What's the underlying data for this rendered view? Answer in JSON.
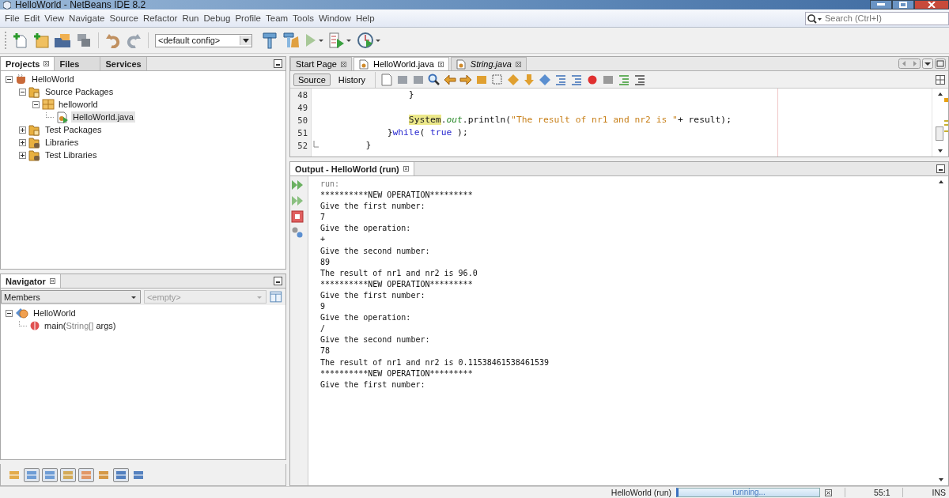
{
  "window": {
    "title": "HelloWorld - NetBeans IDE 8.2"
  },
  "menu": [
    "File",
    "Edit",
    "View",
    "Navigate",
    "Source",
    "Refactor",
    "Run",
    "Debug",
    "Profile",
    "Team",
    "Tools",
    "Window",
    "Help"
  ],
  "search": {
    "placeholder": "Search (Ctrl+I)"
  },
  "toolbar": {
    "config": "<default config>"
  },
  "projects": {
    "tabs": [
      {
        "label": "Projects",
        "selected": true
      },
      {
        "label": "Files",
        "selected": false
      },
      {
        "label": "Services",
        "selected": false
      }
    ],
    "tree": [
      {
        "label": "HelloWorld",
        "kind": "project",
        "expanded": true,
        "selected": false,
        "children": [
          {
            "label": "Source Packages",
            "kind": "source-folder",
            "expanded": true,
            "selected": false,
            "children": [
              {
                "label": "helloworld",
                "kind": "package",
                "expanded": true,
                "selected": false,
                "children": [
                  {
                    "label": "HelloWorld.java",
                    "kind": "java-file",
                    "selected": true
                  }
                ]
              }
            ]
          },
          {
            "label": "Test Packages",
            "kind": "source-folder",
            "expanded": false,
            "selected": false
          },
          {
            "label": "Libraries",
            "kind": "library",
            "expanded": false,
            "selected": false
          },
          {
            "label": "Test Libraries",
            "kind": "library",
            "expanded": false,
            "selected": false
          }
        ]
      }
    ]
  },
  "navigator": {
    "title": "Navigator",
    "filter": "Members",
    "secondary": {
      "placeholder": "<empty>"
    },
    "tree": [
      {
        "kind": "class",
        "expanded": true,
        "segments": [
          {
            "text": "HelloWorld",
            "kind": "name"
          }
        ],
        "children": [
          {
            "kind": "method",
            "segments": [
              {
                "text": "main(",
                "kind": "name"
              },
              {
                "text": "String[]",
                "kind": "type"
              },
              {
                "text": " args)",
                "kind": "name"
              }
            ]
          }
        ]
      }
    ]
  },
  "editor": {
    "tabs": [
      {
        "label": "Start Page",
        "selected": false,
        "preview": false
      },
      {
        "label": "HelloWorld.java",
        "selected": true,
        "preview": false
      },
      {
        "label": "String.java",
        "selected": false,
        "preview": true
      }
    ],
    "views": [
      {
        "label": "Source",
        "selected": true
      },
      {
        "label": "History",
        "selected": false
      }
    ],
    "lines": [
      {
        "number": "48",
        "segments": [
          {
            "text": "                }",
            "kind": "plain"
          }
        ]
      },
      {
        "number": "49"
      },
      {
        "number": "50",
        "segments": [
          {
            "text": "                System",
            "kind": "highlight"
          },
          {
            "text": ".",
            "kind": "plain"
          },
          {
            "text": "out",
            "kind": "field"
          },
          {
            "text": ".println(",
            "kind": "plain"
          },
          {
            "text": "\"The result of nr1 and nr2 is \"",
            "kind": "string"
          },
          {
            "text": "+ result);",
            "kind": "plain"
          }
        ]
      },
      {
        "number": "51",
        "segments": [
          {
            "text": "            }",
            "kind": "plain"
          },
          {
            "text": "while",
            "kind": "keyword"
          },
          {
            "text": "( ",
            "kind": "plain"
          },
          {
            "text": "true",
            "kind": "keyword"
          },
          {
            "text": " );",
            "kind": "plain"
          }
        ]
      },
      {
        "number": "52",
        "fold_end": true,
        "segments": [
          {
            "text": "        }",
            "kind": "plain"
          }
        ]
      }
    ]
  },
  "output": {
    "title": "Output - HelloWorld (run)",
    "lines": [
      {
        "text": "run:",
        "kind": "info"
      },
      {
        "text": "**********NEW OPERATION*********",
        "kind": "stdout"
      },
      {
        "text": "Give the first number:",
        "kind": "stdout"
      },
      {
        "text": "7",
        "kind": "stdout"
      },
      {
        "text": "Give the operation:",
        "kind": "stdout"
      },
      {
        "text": "+",
        "kind": "stdout"
      },
      {
        "text": "Give the second number:",
        "kind": "stdout"
      },
      {
        "text": "89",
        "kind": "stdout"
      },
      {
        "text": "The result of nr1 and nr2 is 96.0",
        "kind": "stdout"
      },
      {
        "text": "**********NEW OPERATION*********",
        "kind": "stdout"
      },
      {
        "text": "Give the first number:",
        "kind": "stdout"
      },
      {
        "text": "9",
        "kind": "stdout"
      },
      {
        "text": "Give the operation:",
        "kind": "stdout"
      },
      {
        "text": "/",
        "kind": "stdout"
      },
      {
        "text": "Give the second number:",
        "kind": "stdout"
      },
      {
        "text": "78",
        "kind": "stdout"
      },
      {
        "text": "The result of nr1 and nr2 is 0.11538461538461539",
        "kind": "stdout"
      },
      {
        "text": "**********NEW OPERATION*********",
        "kind": "stdout"
      },
      {
        "text": "Give the first number:",
        "kind": "stdout"
      }
    ]
  },
  "status_bar": {
    "task": "HelloWorld (run)",
    "progress": "running...",
    "level": 1,
    "position": "55:1",
    "mode": "INS"
  }
}
